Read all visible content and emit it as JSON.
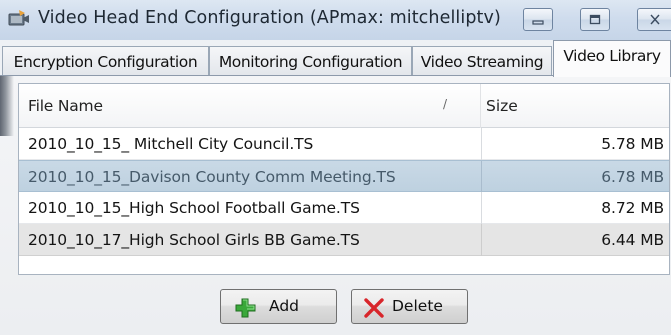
{
  "window": {
    "title": "Video Head End Configuration (APmax: mitchelliptv)"
  },
  "tabs": [
    {
      "label": "Encryption Configuration"
    },
    {
      "label": "Monitoring Configuration"
    },
    {
      "label": "Video Streaming"
    },
    {
      "label": "Video Library",
      "selected": true
    }
  ],
  "list": {
    "columns": {
      "file_name": "File Name",
      "sort_indicator": "/",
      "size": "Size"
    },
    "rows": [
      {
        "file_name": "2010_10_15_ Mitchell City Council.TS",
        "size": "5.78 MB"
      },
      {
        "file_name": "2010_10_15_Davison County Comm Meeting.TS",
        "size": "6.78 MB",
        "selected": true
      },
      {
        "file_name": "2010_10_15_High School Football Game.TS",
        "size": "8.72 MB"
      },
      {
        "file_name": "2010_10_17_High School Girls BB Game.TS",
        "size": "6.44 MB"
      }
    ]
  },
  "buttons": {
    "add": {
      "label": "Add",
      "icon": "green-plus-icon"
    },
    "delete": {
      "label": "Delete",
      "icon": "red-x-icon"
    }
  },
  "colors": {
    "selected_row": "#c4d5e3",
    "alt_row": "#e5e5e5",
    "add_icon": "#3aa83a",
    "delete_icon": "#d8262b"
  }
}
